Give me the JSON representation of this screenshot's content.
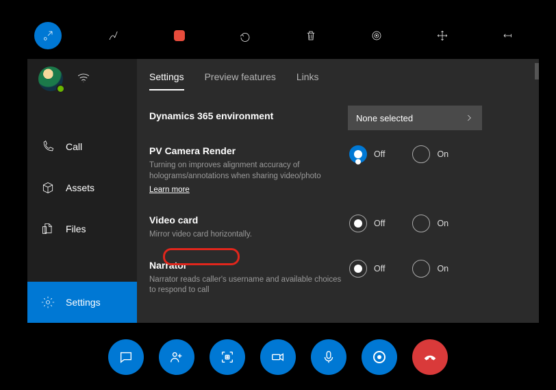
{
  "toolbar": {
    "items": [
      "collapse",
      "ink",
      "record",
      "undo",
      "delete",
      "focus",
      "move",
      "pin"
    ]
  },
  "sidebar": {
    "items": [
      {
        "label": "Call"
      },
      {
        "label": "Assets"
      },
      {
        "label": "Files"
      },
      {
        "label": "Settings"
      }
    ]
  },
  "tabs": [
    {
      "label": "Settings"
    },
    {
      "label": "Preview features"
    },
    {
      "label": "Links"
    }
  ],
  "settings": {
    "env": {
      "title": "Dynamics 365 environment",
      "select_label": "None selected"
    },
    "pv": {
      "title": "PV Camera Render",
      "desc": "Turning on improves alignment accuracy of holograms/annotations when sharing video/photo",
      "learn_more": "Learn more",
      "off": "Off",
      "on": "On"
    },
    "video": {
      "title": "Video card",
      "desc": "Mirror video card horizontally.",
      "off": "Off",
      "on": "On"
    },
    "narrator": {
      "title": "Narrator",
      "desc": "Narrator reads caller's username and available choices to respond to call",
      "off": "Off",
      "on": "On"
    }
  },
  "action_bar": {
    "items": [
      "chat",
      "people",
      "capture",
      "video",
      "mic",
      "record",
      "end-call"
    ]
  }
}
